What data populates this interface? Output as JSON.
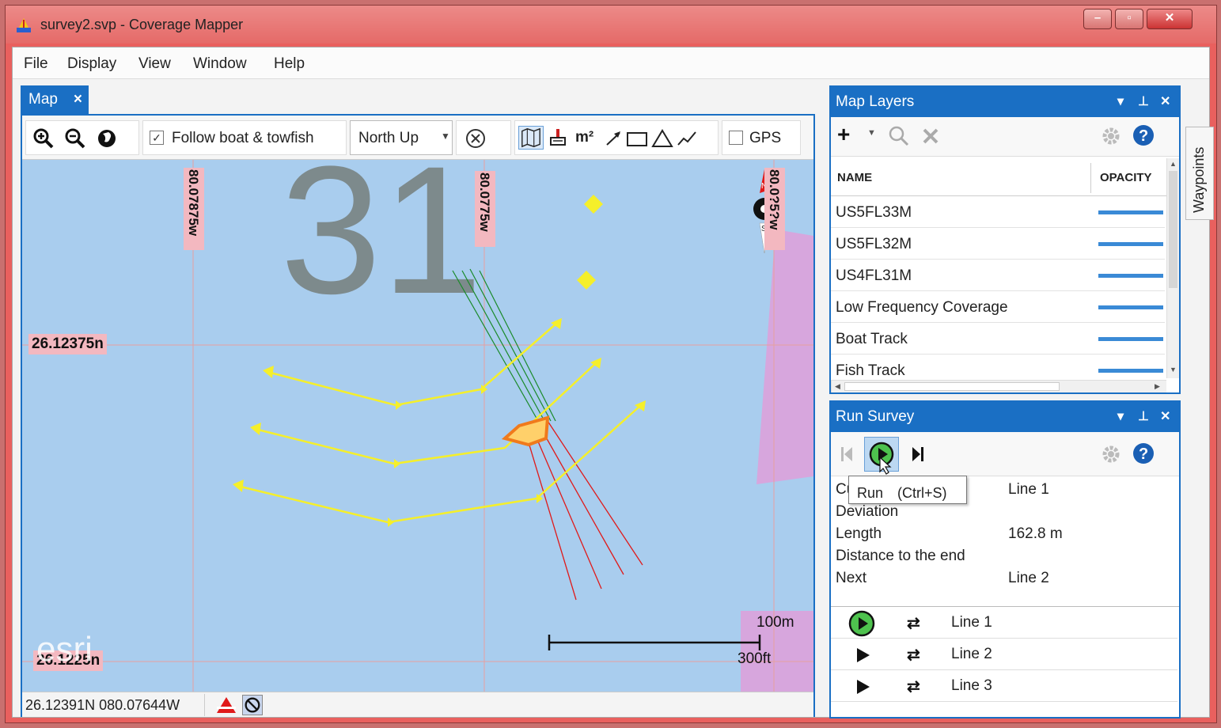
{
  "window": {
    "title": "survey2.svp - Coverage Mapper",
    "controls": {
      "minimize": "–",
      "maximize": "▫",
      "close": "✕"
    }
  },
  "menu": [
    "File",
    "Display",
    "View",
    "Window",
    "Help"
  ],
  "map_tab": {
    "label": "Map",
    "close": "×"
  },
  "toolbar": {
    "follow_label": "Follow boat & towfish",
    "follow_checked": true,
    "orientation": "North Up",
    "area_unit": "m²",
    "gps_label": "GPS",
    "gps_checked": false
  },
  "map": {
    "grid_labels": {
      "lon_left": "80.07875w",
      "lon_mid": "80.0775w",
      "lon_right": "80.0?5?w",
      "lat_top": "26.12375n",
      "lat_bottom": "26.1225n"
    },
    "chart_number": "31",
    "compass": {
      "n": "N",
      "s": "S"
    },
    "scale": {
      "metric": "100m",
      "imperial": "300ft"
    },
    "watermark": "esri",
    "colors": {
      "water": "#a9cdee",
      "survey_lines": "#f5ef2a",
      "boat": "#f07a1c",
      "fish_beams": "#e01a1a",
      "track": "#1a8a2a",
      "land_shade": "#d7a6dd"
    }
  },
  "status": {
    "coordinates": "26.12391N 080.07644W"
  },
  "layers_panel": {
    "title": "Map Layers",
    "col_name": "NAME",
    "col_opacity": "OPACITY",
    "layers": [
      {
        "name": "US5FL33M",
        "opacity": 1.0
      },
      {
        "name": "US5FL32M",
        "opacity": 1.0
      },
      {
        "name": "US4FL31M",
        "opacity": 1.0
      },
      {
        "name": "Low Frequency Coverage",
        "opacity": 1.0
      },
      {
        "name": "Boat Track",
        "opacity": 1.0
      },
      {
        "name": "Fish Track",
        "opacity": 1.0
      }
    ]
  },
  "run_panel": {
    "title": "Run Survey",
    "tooltip": "Run　(Ctrl+S)",
    "fields": [
      {
        "label": "Curren",
        "value": "Line 1"
      },
      {
        "label": "Deviation",
        "value": ""
      },
      {
        "label": "Length",
        "value": "162.8 m"
      },
      {
        "label": "Distance to the end",
        "value": ""
      },
      {
        "label": "Next",
        "value": "Line 2"
      }
    ],
    "lines": [
      "Line 1",
      "Line 2",
      "Line 3"
    ]
  },
  "waypoints_tab": "Waypoints"
}
